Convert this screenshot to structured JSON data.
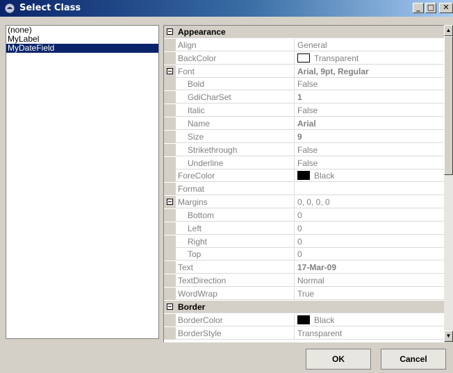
{
  "window": {
    "title": "Select Class",
    "minimize_glyph": "_",
    "maximize_glyph": "□",
    "close_glyph": "✕"
  },
  "class_list": {
    "items": [
      "(none)",
      "MyLabel",
      "MyDateField"
    ],
    "selected": "MyDateField"
  },
  "property_grid": {
    "rows": [
      {
        "type": "category",
        "name": "Appearance",
        "toggle": true
      },
      {
        "type": "prop",
        "name": "Align",
        "value": "General"
      },
      {
        "type": "prop",
        "name": "BackColor",
        "value": "Transparent",
        "swatch": "#ffffff"
      },
      {
        "type": "prop",
        "name": "Font",
        "value": "Arial, 9pt, Regular",
        "toggle": true,
        "bold": true
      },
      {
        "type": "prop",
        "name": "Bold",
        "value": "False",
        "indent": true
      },
      {
        "type": "prop",
        "name": "GdiCharSet",
        "value": "1",
        "indent": true,
        "bold": true
      },
      {
        "type": "prop",
        "name": "Italic",
        "value": "False",
        "indent": true
      },
      {
        "type": "prop",
        "name": "Name",
        "value": "Arial",
        "indent": true,
        "bold": true
      },
      {
        "type": "prop",
        "name": "Size",
        "value": "9",
        "indent": true,
        "bold": true
      },
      {
        "type": "prop",
        "name": "Strikethrough",
        "value": "False",
        "indent": true
      },
      {
        "type": "prop",
        "name": "Underline",
        "value": "False",
        "indent": true
      },
      {
        "type": "prop",
        "name": "ForeColor",
        "value": "Black",
        "swatch": "#000000"
      },
      {
        "type": "prop",
        "name": "Format",
        "value": ""
      },
      {
        "type": "prop",
        "name": "Margins",
        "value": "0, 0, 0, 0",
        "toggle": true
      },
      {
        "type": "prop",
        "name": "Bottom",
        "value": "0",
        "indent": true
      },
      {
        "type": "prop",
        "name": "Left",
        "value": "0",
        "indent": true
      },
      {
        "type": "prop",
        "name": "Right",
        "value": "0",
        "indent": true
      },
      {
        "type": "prop",
        "name": "Top",
        "value": "0",
        "indent": true
      },
      {
        "type": "prop",
        "name": "Text",
        "value": "17-Mar-09",
        "bold": true
      },
      {
        "type": "prop",
        "name": "TextDirection",
        "value": "Normal"
      },
      {
        "type": "prop",
        "name": "WordWrap",
        "value": "True"
      },
      {
        "type": "category",
        "name": "Border",
        "toggle": true
      },
      {
        "type": "prop",
        "name": "BorderColor",
        "value": "Black",
        "swatch": "#000000"
      },
      {
        "type": "prop",
        "name": "BorderStyle",
        "value": "Transparent"
      }
    ]
  },
  "scrollbar": {
    "up_glyph": "▲",
    "down_glyph": "▼"
  },
  "buttons": {
    "ok": "OK",
    "cancel": "Cancel"
  },
  "colors": {
    "titlebar": "#0a246a",
    "selection": "#0a246a",
    "dialog_bg": "#d4d0c8"
  }
}
